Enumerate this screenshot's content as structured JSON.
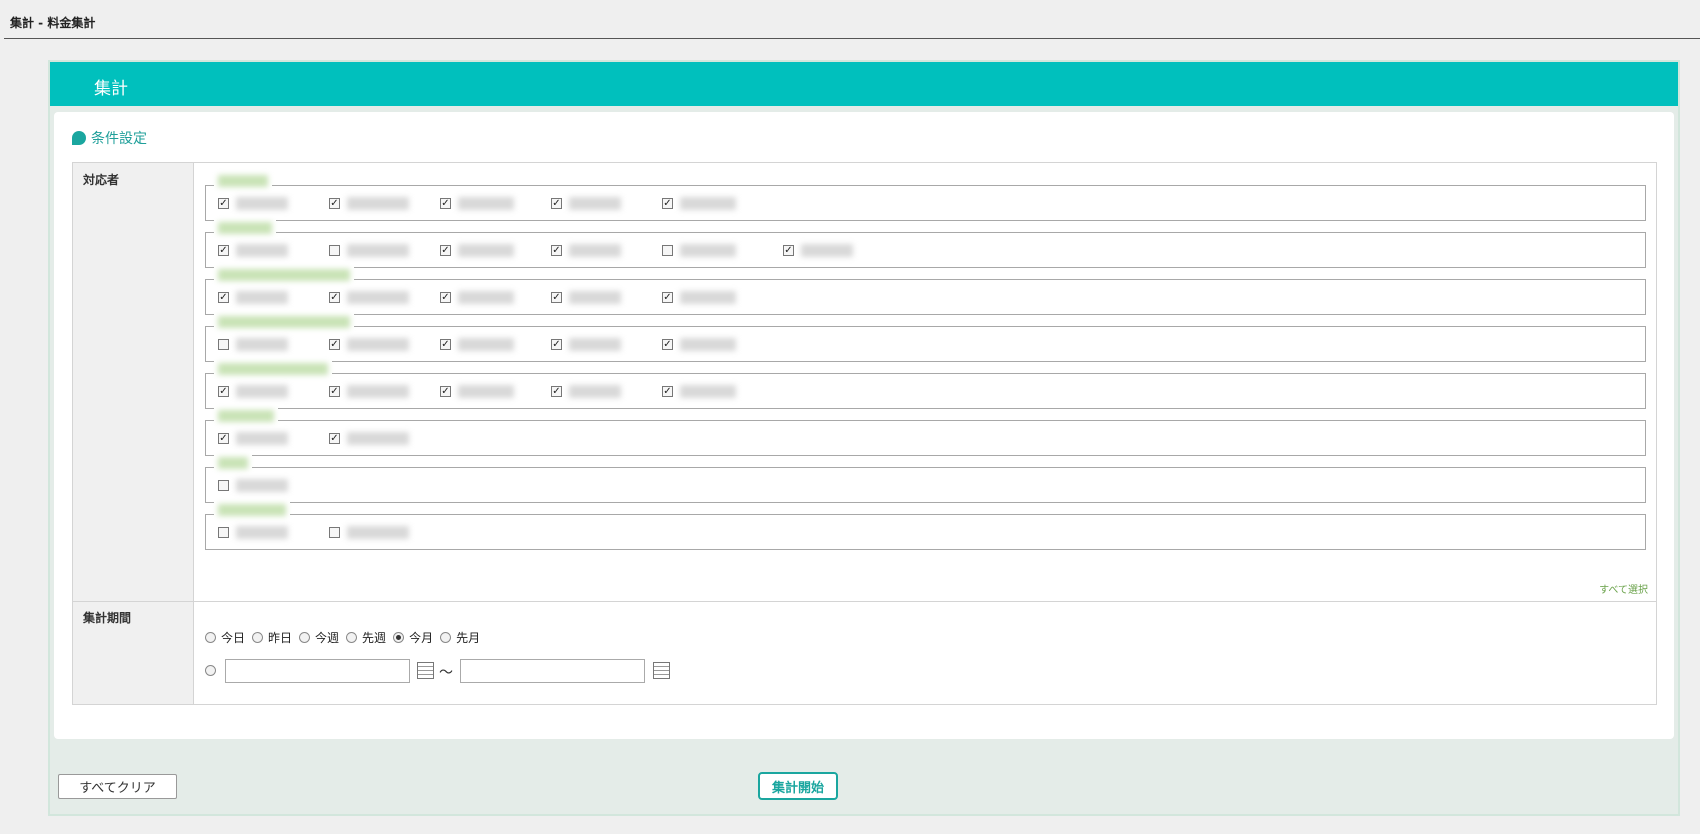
{
  "header": {
    "title": "集計 - 料金集計"
  },
  "panel": {
    "title": "集計"
  },
  "conditions": {
    "section_title": "条件設定",
    "responder_label": "対応者",
    "period_label": "集計期間",
    "select_all": "すべて選択",
    "groups": [
      {
        "members": [
          true,
          true,
          true,
          true,
          true
        ]
      },
      {
        "members": [
          true,
          false,
          true,
          true,
          false,
          true
        ]
      },
      {
        "members": [
          true,
          true,
          true,
          true,
          true
        ]
      },
      {
        "members": [
          false,
          true,
          true,
          true,
          true
        ]
      },
      {
        "members": [
          true,
          true,
          true,
          true,
          true
        ]
      },
      {
        "members": [
          true,
          true
        ]
      },
      {
        "members": [
          false
        ]
      },
      {
        "members": [
          false,
          false
        ]
      }
    ],
    "period_options": [
      {
        "label": "今日",
        "selected": false
      },
      {
        "label": "昨日",
        "selected": false
      },
      {
        "label": "今週",
        "selected": false
      },
      {
        "label": "先週",
        "selected": false
      },
      {
        "label": "今月",
        "selected": true
      },
      {
        "label": "先月",
        "selected": false
      }
    ],
    "range_separator": "～",
    "range_from": "",
    "range_to": ""
  },
  "buttons": {
    "clear_all": "すべてクリア",
    "start": "集計開始"
  }
}
